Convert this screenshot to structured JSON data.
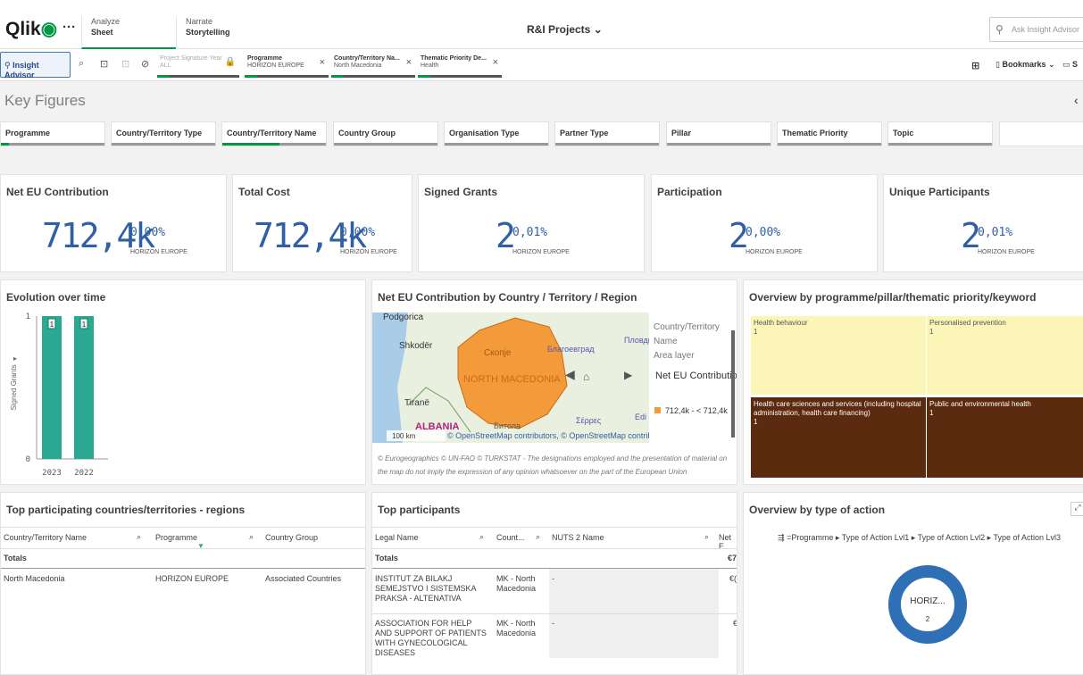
{
  "header": {
    "logo_text": "Qlik",
    "menu_icon": "ellipsis-icon",
    "tabs": [
      {
        "top": "Analyze",
        "bottom": "Sheet"
      },
      {
        "top": "Narrate",
        "bottom": "Storytelling"
      }
    ],
    "app_title": "R&I Projects",
    "search_placeholder": "Ask Insight Advisor"
  },
  "toolbar": {
    "insight_advisor": "Insight Advisor",
    "selections": [
      {
        "title": "Project Signature Year",
        "value": "ALL"
      },
      {
        "title": "Programme",
        "value": "HORIZON EUROPE"
      },
      {
        "title": "Country/Territory Na...",
        "value": "North Macedonia"
      },
      {
        "title": "Thematic Priority De...",
        "value": "Health"
      }
    ],
    "bookmarks": "Bookmarks",
    "sheet_short": "S"
  },
  "sheet": {
    "title": "Key Figures",
    "filters": [
      "Programme",
      "Country/Territory Type",
      "Country/Territory Name",
      "Country Group",
      "Organisation Type",
      "Partner Type",
      "Pillar",
      "Thematic Priority",
      "Topic"
    ]
  },
  "kpis": [
    {
      "title": "Net EU Contribution",
      "value": "712,4k",
      "pct": "0,00%",
      "sub": "HORIZON EUROPE"
    },
    {
      "title": "Total Cost",
      "value": "712,4k",
      "pct": "0,00%",
      "sub": "HORIZON EUROPE"
    },
    {
      "title": "Signed Grants",
      "value": "2",
      "pct": "0,01%",
      "sub": "HORIZON EUROPE"
    },
    {
      "title": "Participation",
      "value": "2",
      "pct": "0,00%",
      "sub": "HORIZON EUROPE"
    },
    {
      "title": "Unique Participants",
      "value": "2",
      "pct": "0,01%",
      "sub": "HORIZON EUROPE"
    }
  ],
  "evolution": {
    "title": "Evolution over time",
    "ylabel": "Signed Grants",
    "y_ticks": [
      "0",
      "1"
    ]
  },
  "chart_data": {
    "type": "bar",
    "categories": [
      "2023",
      "2022"
    ],
    "values": [
      1,
      1
    ],
    "data_labels": [
      "1",
      "1"
    ],
    "ylabel": "Signed Grants",
    "ylim": [
      0,
      1
    ],
    "color": "#2aa891",
    "grid": false
  },
  "map": {
    "title": "Net EU Contribution by Country / Territory / Region",
    "labels": {
      "podgorica": "Podgorica",
      "shkoder": "Shkodër",
      "skopje": "Скопје",
      "blagoevgrad": "Благоевград",
      "plovdiv": "Пловди",
      "country": "NORTH MACEDONIA",
      "tirane": "Tiranë",
      "albania": "ALBANIA",
      "bitola": "Битола",
      "serres": "Σέρρες",
      "edirne": "Edi",
      "scale": "100 km",
      "osm": "© OpenStreetMap contributors, © OpenStreetMap contributors"
    },
    "legend": {
      "line1": "Country/Territory",
      "line2": "Name",
      "line3": "Area layer",
      "metric": "Net EU Contribution",
      "range": "712,4k - < 712,4k"
    },
    "footnote": "© Eurogeographics © UN-FAO © TURKSTAT - The designations employed and the presentation of material on the map do not imply the expression of any opinion whatsoever on the part of the European Union",
    "country_color": "#f39a3b"
  },
  "treemap": {
    "title": "Overview by programme/pillar/thematic priority/keyword",
    "cells": [
      {
        "label": "Health behaviour",
        "value": "1"
      },
      {
        "label": "Personalised prevention",
        "value": "1"
      },
      {
        "label": "Health care sciences and services (including hospital administration, health care financing)",
        "value": "1"
      },
      {
        "label": "Public and environmental health",
        "value": "1"
      }
    ]
  },
  "countries_table": {
    "title": "Top participating countries/territories - regions",
    "headers": [
      "Country/Territory Name",
      "Programme",
      "Country Group"
    ],
    "totals": "Totals",
    "rows": [
      [
        "North Macedonia",
        "HORIZON EUROPE",
        "Associated Countries"
      ]
    ]
  },
  "participants_table": {
    "title": "Top participants",
    "headers": [
      "Legal Name",
      "Count...",
      "NUTS 2 Name",
      "Net E"
    ],
    "totals": "Totals",
    "totals_amount": "€7",
    "rows": [
      {
        "name": "INSTITUT ZA BILAKJ SEMEJSTVO I SISTEMSKA PRAKSA - ALTENATIVA",
        "country": "MK - North Macedonia",
        "nuts": "-",
        "amount": "€("
      },
      {
        "name": "ASSOCIATION FOR HELP AND SUPPORT OF PATIENTS WITH GYNECOLOGICAL DISEASES",
        "country": "MK - North Macedonia",
        "nuts": "-",
        "amount": "€"
      }
    ]
  },
  "action_type": {
    "title": "Overview by type of action",
    "breadcrumb": [
      "=Programme",
      "Type of Action Lvl1",
      "Type of Action Lvl2",
      "Type of Action Lvl3"
    ],
    "donut_label": "HORIZ...",
    "donut_value": "2",
    "donut_color": "#2e6fb5"
  }
}
